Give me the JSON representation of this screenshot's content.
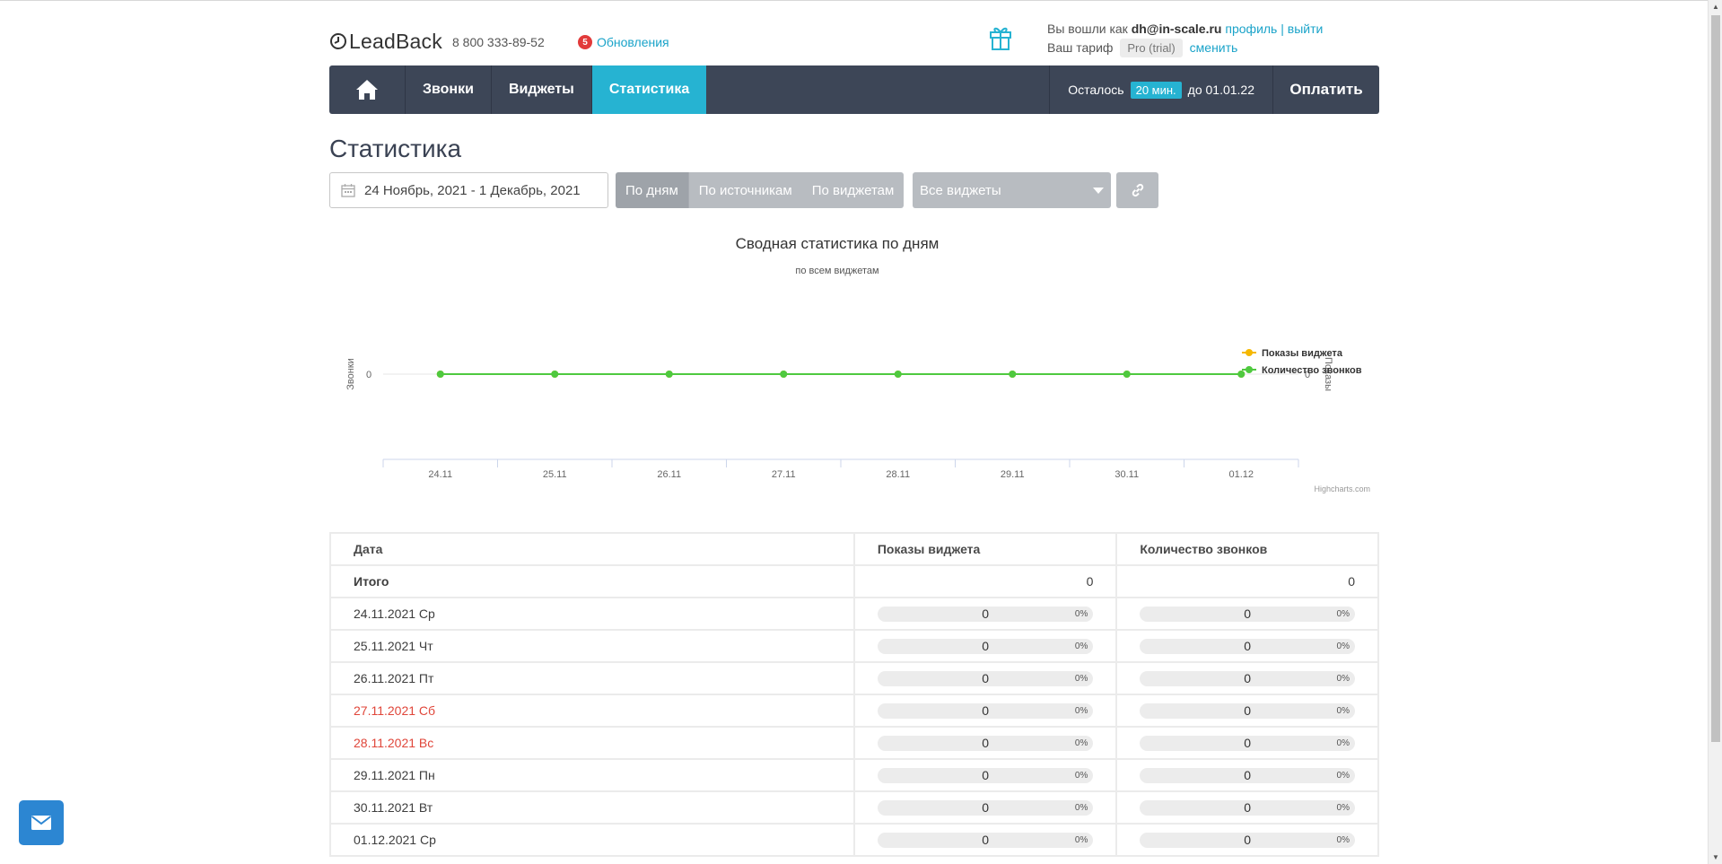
{
  "header": {
    "logo_text": "LeadBack",
    "phone": "8 800 333-89-52",
    "updates_count": "5",
    "updates_label": "Обновления",
    "logged_in_prefix": "Вы вошли как",
    "email": "dh@in-scale.ru",
    "profile_link": "профиль",
    "separator": "|",
    "logout_link": "выйти",
    "tariff_prefix": "Ваш тариф",
    "tariff_name": "Pro (trial)",
    "change_link": "сменить"
  },
  "nav": {
    "items": [
      {
        "label": "Звонки"
      },
      {
        "label": "Виджеты"
      },
      {
        "label": "Статистика"
      }
    ],
    "remain_prefix": "Осталось",
    "remain_value": "20 мин.",
    "remain_suffix": "до 01.01.22",
    "pay_label": "Оплатить"
  },
  "page": {
    "title": "Статистика",
    "date_range": "24 Ноябрь, 2021 - 1 Декабрь, 2021",
    "group_buttons": [
      "По дням",
      "По источникам",
      "По виджетам"
    ],
    "widget_select": "Все виджеты"
  },
  "chart_data": {
    "type": "line",
    "title": "Сводная статистика по дням",
    "subtitle": "по всем виджетам",
    "categories": [
      "24.11",
      "25.11",
      "26.11",
      "27.11",
      "28.11",
      "29.11",
      "30.11",
      "01.12"
    ],
    "y_left_label": "Звонки",
    "y_right_label": "Показы",
    "y_left_ticks": [
      "0"
    ],
    "y_right_ticks": [
      "0"
    ],
    "series": [
      {
        "name": "Показы виджета",
        "values": [
          0,
          0,
          0,
          0,
          0,
          0,
          0,
          0
        ],
        "color": "#f5b800"
      },
      {
        "name": "Количество звонков",
        "values": [
          0,
          0,
          0,
          0,
          0,
          0,
          0,
          0
        ],
        "color": "#4fc93f"
      }
    ],
    "legend": "right",
    "credits": "Highcharts.com"
  },
  "table": {
    "headers": [
      "Дата",
      "Показы виджета",
      "Количество звонков"
    ],
    "total": {
      "label": "Итого",
      "shows": "0",
      "calls": "0"
    },
    "rows": [
      {
        "date": "24.11.2021 Ср",
        "shows": "0",
        "shows_pct": "0%",
        "calls": "0",
        "calls_pct": "0%",
        "weekend": false
      },
      {
        "date": "25.11.2021 Чт",
        "shows": "0",
        "shows_pct": "0%",
        "calls": "0",
        "calls_pct": "0%",
        "weekend": false
      },
      {
        "date": "26.11.2021 Пт",
        "shows": "0",
        "shows_pct": "0%",
        "calls": "0",
        "calls_pct": "0%",
        "weekend": false
      },
      {
        "date": "27.11.2021 Сб",
        "shows": "0",
        "shows_pct": "0%",
        "calls": "0",
        "calls_pct": "0%",
        "weekend": true
      },
      {
        "date": "28.11.2021 Вс",
        "shows": "0",
        "shows_pct": "0%",
        "calls": "0",
        "calls_pct": "0%",
        "weekend": true
      },
      {
        "date": "29.11.2021 Пн",
        "shows": "0",
        "shows_pct": "0%",
        "calls": "0",
        "calls_pct": "0%",
        "weekend": false
      },
      {
        "date": "30.11.2021 Вт",
        "shows": "0",
        "shows_pct": "0%",
        "calls": "0",
        "calls_pct": "0%",
        "weekend": false
      },
      {
        "date": "01.12.2021 Ср",
        "shows": "0",
        "shows_pct": "0%",
        "calls": "0",
        "calls_pct": "0%",
        "weekend": false
      }
    ]
  },
  "colors": {
    "nav_bg": "#3d4657",
    "accent": "#26b3d2",
    "link": "#1aa3c9",
    "weekend": "#e0463a",
    "mail_button": "#2c86d2"
  }
}
